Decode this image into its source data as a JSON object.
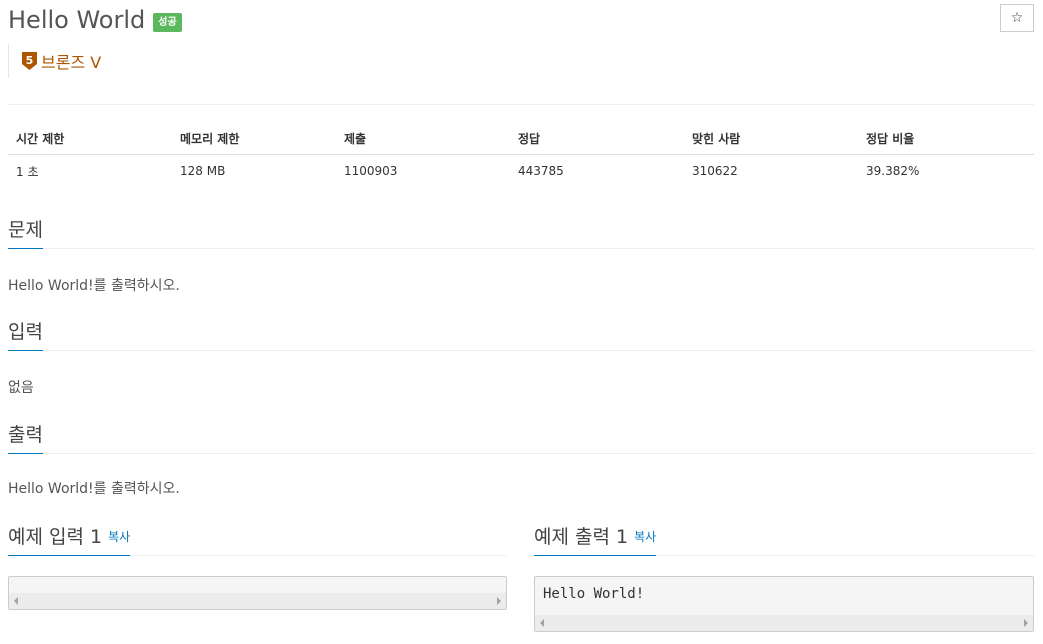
{
  "problem": {
    "title": "Hello World",
    "status_badge": "성공",
    "star_icon": "star-icon",
    "tier": {
      "icon": "bronze-5-tier-icon",
      "number": "5",
      "label": "브론즈 V",
      "color": "#ad5600"
    }
  },
  "info_table": {
    "headers": [
      "시간 제한",
      "메모리 제한",
      "제출",
      "정답",
      "맞힌 사람",
      "정답 비율"
    ],
    "values": [
      "1 초",
      "128 MB",
      "1100903",
      "443785",
      "310622",
      "39.382%"
    ]
  },
  "sections": {
    "problem_heading": "문제",
    "problem_text": "Hello World!를 출력하시오.",
    "input_heading": "입력",
    "input_text": "없음",
    "output_heading": "출력",
    "output_text": "Hello World!를 출력하시오."
  },
  "samples": {
    "input_heading": "예제 입력 1",
    "input_copy": "복사",
    "input_content": "",
    "output_heading": "예제 출력 1",
    "output_copy": "복사",
    "output_content": "Hello World!"
  },
  "colors": {
    "badge": "#5cb85c",
    "accent": "#0076c0",
    "tier": "#ad5600"
  }
}
